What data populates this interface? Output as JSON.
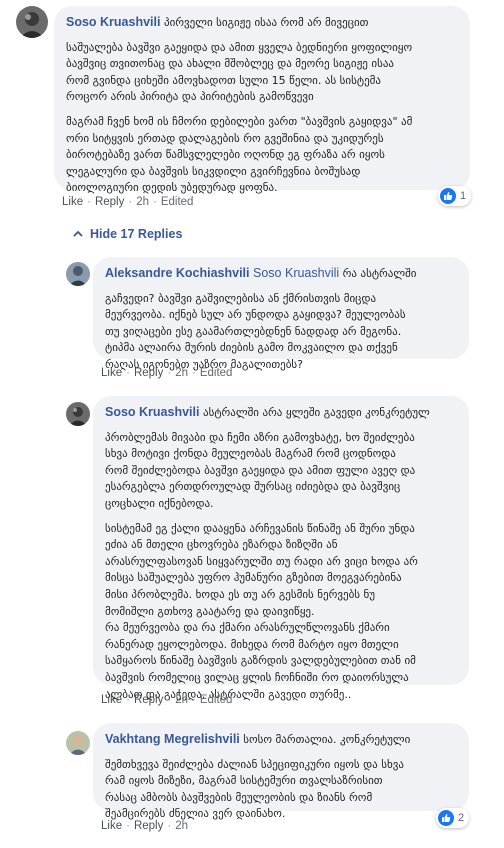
{
  "comments": [
    {
      "author": "Soso Kruashvili",
      "mention": "",
      "lead": "პირველი სიგიჟე ისაა რომ არ მივეცით",
      "paragraphs": [
        "საშუალება ბავშვი გაეყიდა და ამით ყველა ბედნიერი ყოფილიყო\nბავშვიც თვითონაც და ახალი მშობლეც და მეორე სიგიჟე ისაა\nრომ გვინდა ციხეში ამოვხადოთ სული 15 წელი. ას სისტემა\nროცორ არის პირიტა და პირიტების გამოწვევი",
        "მაგრამ ჩვენ ხომ ის ჩმორი დებილები ვართ \"ბავშვის გაყიდვა\" ამ\nორი სიტყვის ერთად დალაგების რო გვეშინია და უკიდურეს\nბიროტებაზე ვართ წამსვლელები ოღონდ ეგ ფრაზა არ იყოს\nლეგალური და ბავშვის სიკვდილი გვირჩევნია ბოშუსად\nბიოლოგიური დედის უბედურად ყოფნა."
      ],
      "actions": [
        "Like",
        "Reply",
        "2h",
        "Edited"
      ],
      "reactions": "1"
    },
    {
      "author": "Aleksandre Kochiashvili",
      "mention": "Soso Kruashvili",
      "lead": "რა ასტრალში",
      "paragraphs": [
        "გაჩვედი? ბავშვი გაშვილებისა ან ქმრისთვის მიცდა\nმეურვეობა. იქნებ სულ არ უნდოდა გაყიდვა? მეულეობას\nთუ ვიღაცები ესე გაამართლებდნენ ნადდად არ მეგონა.\nტიპმა ალაირა მურის ძიების გამო მოკვაილო და თქვენ\nრაღას იგონებთ უაზრო მაგალითებს?"
      ],
      "actions": [
        "Like",
        "Reply",
        "2h",
        "Edited"
      ]
    },
    {
      "author": "Soso Kruashvili",
      "mention": "",
      "lead": "ასტრალში არა ყლეში გავედი კონკრეტულ",
      "paragraphs": [
        "პრობლემას მივაბი და ჩემი აზრი გამოვხატე, ხო შეიძლება\nსხვა მოტივი ქონდა მეულეობას მაგრამ რომ ცოდნოდა\nრომ შეიძლებოდა ბავშვი გაეყიდა და ამით ფული ავეღ და\nესარგებლა ერთდროულად შურსაც იძიებდა და ბავშვიც\nცოცხალი იქნებოდა.",
        "სისტემამ ეგ ქალი დააყენა არჩევანის წინაშე ან შური უნდა\nეძია ან მთელი ცხოვრება ეზარდა ზიზღში ან\nარასრულფასოვან სიყვარულში თუ რადი არ ვიცი ხოდა არ\nმისცა საშუალება უფრო ჰუმანური გზებით მოეგვარებინა\nმისი პრობლემა. ხოდა ეს თუ არ გესმის ნერვებს ნუ\nმომიშლი გთხოვ გაატარე და დაივიწყე.\nრა მეურვეობა და რა ქმარი არასრულწლოვანს ქმარი\nრანერად ეყოლებოდა. მიხედა რომ მარტო იყო მთელი\nსამყაროს წინაშე ბავშვის გაზრდის ვალდებულებით თან იმ\nბავშვის რომელიც ვილაც ყლის ჩოჩნიში რო დაიორსულა\nალბათ და გაჭედა. ასტრალში გავედი თურმე.."
      ],
      "actions": [
        "Like",
        "Reply",
        "2h",
        "Edited"
      ]
    },
    {
      "author": "Vakhtang Megrelishvili",
      "mention": "",
      "lead": "სოსო მართალია. კონკრეტული",
      "paragraphs": [
        "შემთხვევა შეიძლება ძალიან სპეციფიკური იყოს და სხვა\nრამ იყოს მიზეზი, მაგრამ სისტემური თვალსაზრისით\nრასაც ამბობს ბავშვების მეულეობის და ზიანს რომ\nშეამცირებს ძნელია ვერ დაინახო."
      ],
      "actions": [
        "Like",
        "Reply",
        "2h"
      ],
      "reactions": "2"
    }
  ],
  "hide_replies_label": "Hide 17 Replies",
  "colors": {
    "bubble": "#f0f2f5",
    "link": "#385898",
    "like": "#1877f2",
    "meta": "#65676b"
  }
}
